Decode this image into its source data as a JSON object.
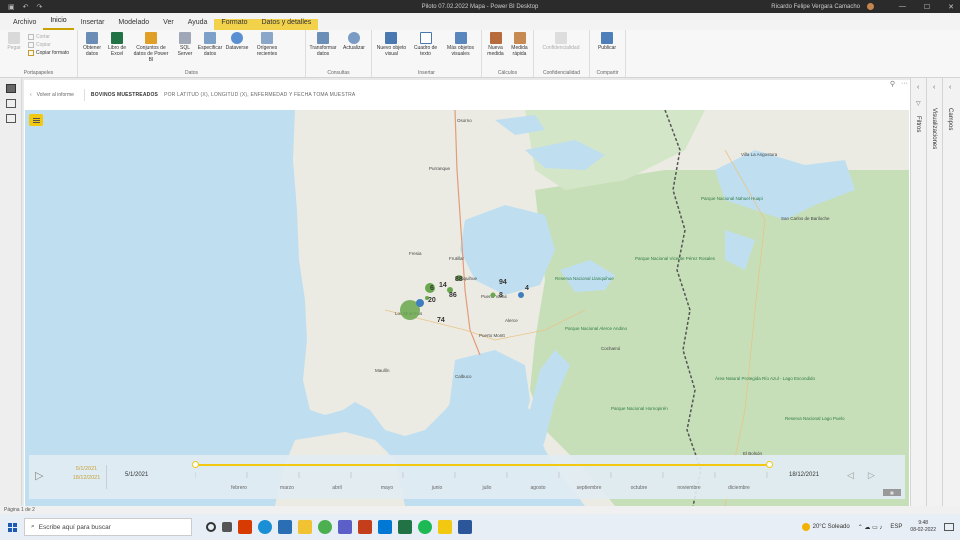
{
  "titlebar": {
    "title": "Piloto 07.02.2022 Mapa - Power BI Desktop",
    "user": "Ricardo Felipe Vergara Camacho"
  },
  "menu": {
    "tabs": [
      {
        "label": "Archivo"
      },
      {
        "label": "Inicio"
      },
      {
        "label": "Insertar"
      },
      {
        "label": "Modelado"
      },
      {
        "label": "Ver"
      },
      {
        "label": "Ayuda"
      },
      {
        "label": "Formato"
      },
      {
        "label": "Datos y detalles"
      }
    ]
  },
  "ribbon": {
    "portapapeles": {
      "name": "Portapapeles",
      "pegar": "Pegar",
      "cortar": "Cortar",
      "copiar": "Copiar",
      "copiar_formato": "Copiar formato"
    },
    "datos": {
      "name": "Datos",
      "obtener": "Obtener datos",
      "excel": "Libro de Excel",
      "conjuntos": "Conjuntos de datos de Power BI",
      "sql": "SQL Server",
      "especificar": "Especificar datos",
      "dataverse": "Dataverse",
      "origenes": "Orígenes recientes"
    },
    "consultas": {
      "name": "Consultas",
      "transformar": "Transformar datos",
      "actualizar": "Actualizar"
    },
    "insertar": {
      "name": "Insertar",
      "nuevo_objeto": "Nuevo objeto visual",
      "cuadro_texto": "Cuadro de texto",
      "mas_objetos": "Más objetos visuales"
    },
    "calculos": {
      "name": "Cálculos",
      "nueva_medida": "Nueva medida",
      "medida_rapida": "Medida rápida"
    },
    "confidencialidad": {
      "name": "Confidencialidad",
      "btn": "Confidencialidad"
    },
    "compartir": {
      "name": "Compartir",
      "publicar": "Publicar"
    }
  },
  "visual": {
    "back_label": "Volver al informe",
    "title": "BOVINOS MUESTREADOS",
    "subtitle": "POR LATITUD (X), LONGITUD (X), ENFERMEDAD Y FECHA TOMA MUESTRA"
  },
  "map": {
    "cities": [
      {
        "name": "Osorno"
      },
      {
        "name": "Purranque"
      },
      {
        "name": "Frutillar"
      },
      {
        "name": "Llanquihue"
      },
      {
        "name": "Puerto Varas"
      },
      {
        "name": "Alerce"
      },
      {
        "name": "Puerto Montt"
      },
      {
        "name": "Los Muermos"
      },
      {
        "name": "Fresia"
      },
      {
        "name": "Maullín"
      },
      {
        "name": "Calbuco"
      },
      {
        "name": "San Carlos de Bariloche"
      },
      {
        "name": "Villa La Angostura"
      },
      {
        "name": "El Bolsón"
      },
      {
        "name": "Cochamó"
      }
    ],
    "parks": [
      {
        "name": "Reserva Nacional Llanquihue"
      },
      {
        "name": "Parque Nacional Vicente Pérez Rosales"
      },
      {
        "name": "Parque Nacional Alerce Andino"
      },
      {
        "name": "Parque Nacional Nahuel Huapi"
      },
      {
        "name": "Parque Nacional Hornopirén"
      },
      {
        "name": "Área Natural Protegida Río Azul - Lago Escondido"
      },
      {
        "name": "Reserva Nacional Lago Puelo"
      }
    ],
    "bubbles": [
      {
        "label": "6"
      },
      {
        "label": "14"
      },
      {
        "label": "20"
      },
      {
        "label": "88"
      },
      {
        "label": "86"
      },
      {
        "label": "94"
      },
      {
        "label": "4"
      },
      {
        "label": "8"
      },
      {
        "label": "74"
      }
    ]
  },
  "timeline": {
    "range_start": "5/1/2021",
    "range_end": "18/12/2021",
    "current_start": "5/1/2021",
    "current_end": "18/12/2021",
    "months": [
      "febrero",
      "marzo",
      "abril",
      "mayo",
      "junio",
      "julio",
      "agosto",
      "septiembre",
      "octubre",
      "noviembre",
      "diciembre"
    ]
  },
  "panes": {
    "filtros": "Filtros",
    "visualizaciones": "Visualizaciones",
    "campos": "Campos"
  },
  "status": {
    "page": "Página 1 de 2"
  },
  "taskbar": {
    "search_placeholder": "Escribe aquí para buscar",
    "weather": "20°C  Soleado",
    "lang": "ESP",
    "time": "9:48",
    "date": "08-02-2022"
  },
  "colors": {
    "accent": "#f2c811",
    "bubble": "#6aa84f",
    "water": "#bfdff0",
    "land": "#ecebe3",
    "forest": "#c6dfb8"
  }
}
